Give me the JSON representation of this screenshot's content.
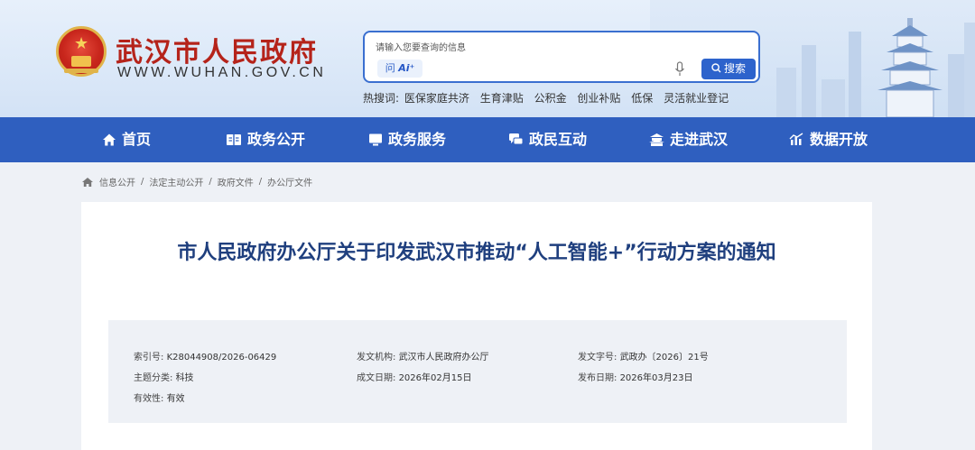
{
  "header": {
    "site_title": "武汉市人民政府",
    "site_url": "WWW.WUHAN.GOV.CN",
    "search": {
      "placeholder": "请输入您要查询的信息",
      "ai_prefix": "问",
      "ai_label": "Ai⁺",
      "button_label": "搜索"
    },
    "hot": {
      "label": "热搜词:",
      "items": [
        "医保家庭共济",
        "生育津贴",
        "公积金",
        "创业补贴",
        "低保",
        "灵活就业登记"
      ]
    }
  },
  "nav": {
    "items": [
      {
        "label": "首页",
        "icon": "home-icon"
      },
      {
        "label": "政务公开",
        "icon": "open-book-icon"
      },
      {
        "label": "政务服务",
        "icon": "monitor-icon"
      },
      {
        "label": "政民互动",
        "icon": "chat-icon"
      },
      {
        "label": "走进武汉",
        "icon": "landmark-icon"
      },
      {
        "label": "数据开放",
        "icon": "chart-icon"
      }
    ]
  },
  "breadcrumb": {
    "items": [
      "信息公开",
      "法定主动公开",
      "政府文件",
      "办公厅文件"
    ],
    "separator": "/"
  },
  "document": {
    "title": "市人民政府办公厅关于印发武汉市推动“人工智能+”行动方案的通知",
    "meta": {
      "index_no": {
        "label": "索引号:",
        "value": "K28044908/2026-06429"
      },
      "issuer": {
        "label": "发文机构:",
        "value": "武汉市人民政府办公厅"
      },
      "doc_no": {
        "label": "发文字号:",
        "value": "武政办〔2026〕21号"
      },
      "category": {
        "label": "主题分类:",
        "value": "科技"
      },
      "created": {
        "label": "成文日期:",
        "value": "2026年02月15日"
      },
      "published": {
        "label": "发布日期:",
        "value": "2026年03月23日"
      },
      "validity": {
        "label": "有效性:",
        "value": "有效"
      }
    }
  },
  "colors": {
    "nav_bg": "#2f5fbf",
    "title_red": "#b5231a",
    "doc_title": "#1f3f7e",
    "search_border": "#3a6fd0"
  }
}
